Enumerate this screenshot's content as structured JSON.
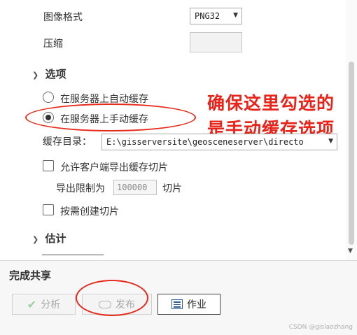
{
  "settings": {
    "image_format_label": "图像格式",
    "image_format_value": "PNG32",
    "compression_label": "压缩"
  },
  "options": {
    "section_title": "选项",
    "radio_auto": "在服务器上自动缓存",
    "radio_manual": "在服务器上手动缓存",
    "selected": "radio_manual",
    "cache_dir_label": "缓存目录：",
    "cache_dir_value": "E:\\gisserversite\\geosceneserver\\directo",
    "allow_export_label": "允许客户端导出缓存切片",
    "export_limit_label": "导出限制为",
    "export_limit_value": "100000",
    "export_limit_unit": "切片",
    "on_demand_label": "按需创建切片"
  },
  "estimate": {
    "section_title": "估计"
  },
  "annotation": {
    "line1": "确保这里勾选的",
    "line2": "是手动缓存选项",
    "color": "#e8231a"
  },
  "footer": {
    "title": "完成共享",
    "analyze_label": "分析",
    "publish_label": "发布",
    "jobs_label": "作业"
  },
  "watermark": "CSDN @gislaozhang"
}
